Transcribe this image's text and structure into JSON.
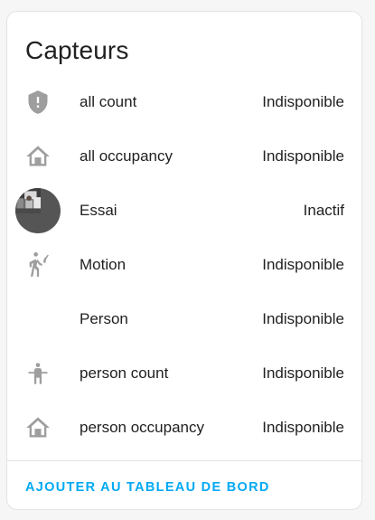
{
  "card": {
    "title": "Capteurs",
    "action_label": "AJOUTER AU TABLEAU DE BORD"
  },
  "entities": [
    {
      "name": "all count",
      "state": "Indisponible",
      "icon": "alert-shield-icon"
    },
    {
      "name": "all occupancy",
      "state": "Indisponible",
      "icon": "home-outline-icon"
    },
    {
      "name": "Essai",
      "state": "Inactif",
      "icon": "camera-thumbnail"
    },
    {
      "name": "Motion",
      "state": "Indisponible",
      "icon": "motion-sensor-icon"
    },
    {
      "name": "Person",
      "state": "Indisponible",
      "icon": ""
    },
    {
      "name": "person count",
      "state": "Indisponible",
      "icon": "human-icon"
    },
    {
      "name": "person occupancy",
      "state": "Indisponible",
      "icon": "home-outline-icon"
    }
  ],
  "colors": {
    "accent": "#03a9f4",
    "icon": "#9e9e9e",
    "text": "#212121"
  }
}
